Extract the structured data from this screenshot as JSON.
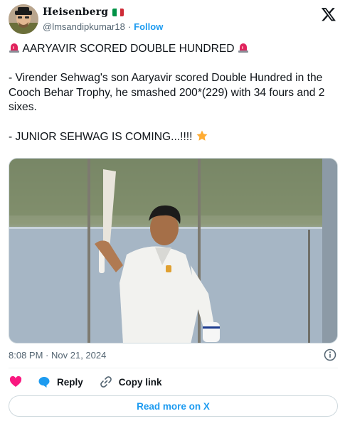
{
  "author": {
    "display_name": "Heisenberg",
    "handle": "@lmsandipkumar18",
    "separator": "·",
    "follow_label": "Follow",
    "flag": "italy-flag-icon"
  },
  "tweet": {
    "headline": "AARYAVIR SCORED DOUBLE HUNDRED",
    "body": "- Virender Sehwag's son Aaryavir scored Double Hundred in the Cooch Behar Trophy, he smashed 200*(229) with 34 fours and 2 sixes.",
    "tagline": "- JUNIOR SEHWAG IS COMING...!!!!",
    "emojis": [
      "police-car-light-icon",
      "star-icon"
    ]
  },
  "meta": {
    "time": "8:08 PM",
    "separator": "·",
    "date": "Nov 21, 2024"
  },
  "actions": {
    "reply_label": "Reply",
    "copy_link_label": "Copy link"
  },
  "footer": {
    "read_more_label": "Read more on X"
  },
  "colors": {
    "accent": "#1d9bf0",
    "like": "#f91880",
    "text": "#0f1419",
    "muted": "#536471",
    "border": "#cfd9de"
  }
}
